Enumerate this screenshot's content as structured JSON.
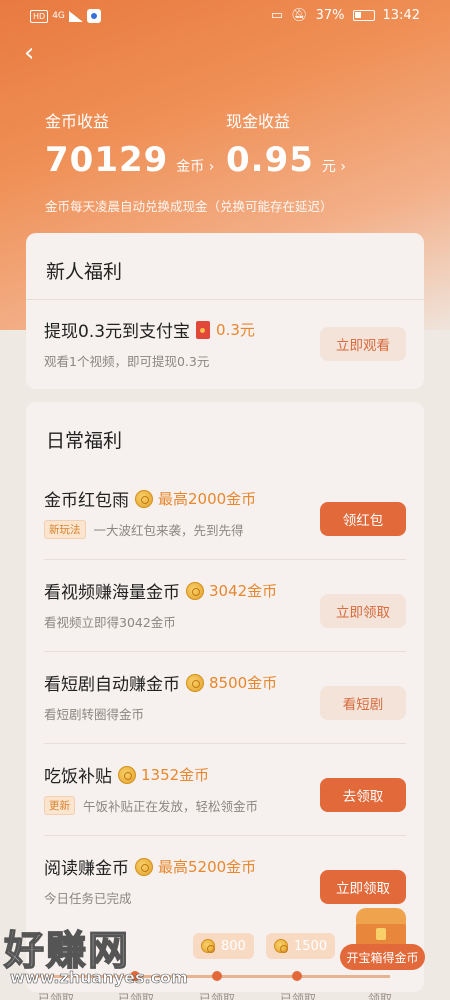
{
  "status_bar": {
    "net_badge": "HD",
    "net_type": "4G",
    "battery": "37%",
    "time": "13:42"
  },
  "header": {
    "coin_label": "金币收益",
    "coin_value": "70129",
    "coin_unit": "金币 ›",
    "cash_label": "现金收益",
    "cash_value": "0.95",
    "cash_unit": "元 ›",
    "note": "金币每天凌晨自动兑换成现金（兑换可能存在延迟）"
  },
  "new_user": {
    "title": "新人福利",
    "task": {
      "title": "提现0.3元到支付宝",
      "reward": "0.3元",
      "desc": "观看1个视频，即可提现0.3元",
      "button": "立即观看"
    }
  },
  "daily": {
    "title": "日常福利",
    "tasks": [
      {
        "title": "金币红包雨",
        "reward": "最高2000金币",
        "tag": "新玩法",
        "desc": "一大波红包来袭，先到先得",
        "button": "领红包",
        "style": "solid"
      },
      {
        "title": "看视频赚海量金币",
        "reward": "3042金币",
        "tag": "",
        "desc": "看视频立即得3042金币",
        "button": "立即领取",
        "style": "light"
      },
      {
        "title": "看短剧自动赚金币",
        "reward": "8500金币",
        "tag": "",
        "desc": "看短剧转圈得金币",
        "button": "看短剧",
        "style": "light"
      },
      {
        "title": "吃饭补贴",
        "reward": "1352金币",
        "tag": "更新",
        "desc": "午饭补贴正在发放，轻松领金币",
        "button": "去领取",
        "style": "solid"
      },
      {
        "title": "阅读赚金币",
        "reward": "最高5200金币",
        "tag": "",
        "desc": "今日任务已完成",
        "button": "立即领取",
        "style": "solid"
      }
    ]
  },
  "bottom": {
    "milestones": [
      "800",
      "1500"
    ],
    "claimed_labels": [
      "已领取",
      "已领取",
      "已领取",
      "已领取",
      "领取"
    ],
    "chest_button": "开宝箱得金币"
  },
  "watermark": {
    "big": "好赚网",
    "url": "www.zhuanyes.com"
  },
  "colors": {
    "accent": "#e2693a",
    "reward": "#e8872e",
    "hero": "#e87a40"
  }
}
